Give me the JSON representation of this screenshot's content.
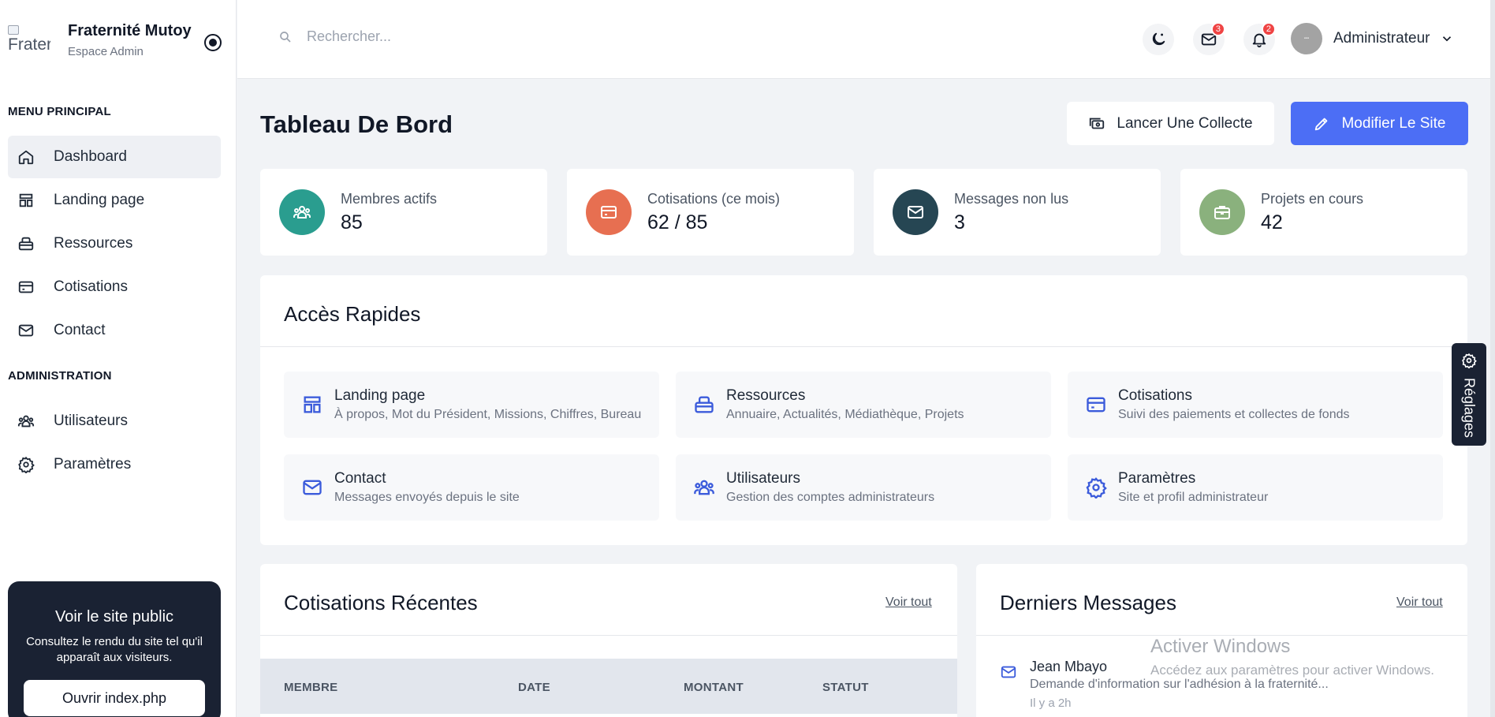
{
  "brand": {
    "logo_alt": "Frater",
    "name": "Fraternité Mutoy",
    "subtitle": "Espace Admin"
  },
  "sidebar": {
    "menu_title": "MENU PRINCIPAL",
    "items": [
      {
        "label": "Dashboard",
        "icon": "home-icon",
        "active": true
      },
      {
        "label": "Landing page",
        "icon": "layout-icon"
      },
      {
        "label": "Ressources",
        "icon": "archive-icon"
      },
      {
        "label": "Cotisations",
        "icon": "credit-card-icon"
      },
      {
        "label": "Contact",
        "icon": "mail-icon"
      }
    ],
    "admin_title": "ADMINISTRATION",
    "admin_items": [
      {
        "label": "Utilisateurs",
        "icon": "users-icon"
      },
      {
        "label": "Paramètres",
        "icon": "gear-icon"
      }
    ],
    "public_card": {
      "title": "Voir le site public",
      "text": "Consultez le rendu du site tel qu'il apparaît aux visiteurs.",
      "button": "Ouvrir index.php"
    }
  },
  "topbar": {
    "search_placeholder": "Rechercher...",
    "messages_count": "3",
    "notifications_count": "2",
    "user_name": "Administrateur"
  },
  "main": {
    "title": "Tableau De Bord",
    "btn_collect": "Lancer Une Collecte",
    "btn_edit": "Modifier Le Site"
  },
  "stats": [
    {
      "label": "Membres actifs",
      "value": "85",
      "color": "#2a9d8f",
      "icon": "users-icon"
    },
    {
      "label": "Cotisations (ce mois)",
      "value": "62 / 85",
      "color": "#e76f51",
      "icon": "credit-card-icon"
    },
    {
      "label": "Messages non lus",
      "value": "3",
      "color": "#264653",
      "icon": "mail-icon"
    },
    {
      "label": "Projets en cours",
      "value": "42",
      "color": "#8ab17d",
      "icon": "briefcase-icon"
    }
  ],
  "quick_access": {
    "title": "Accès Rapides",
    "items": [
      {
        "title": "Landing page",
        "desc": "À propos, Mot du Président, Missions, Chiffres, Bureau"
      },
      {
        "title": "Ressources",
        "desc": "Annuaire, Actualités, Médiathèque, Projets"
      },
      {
        "title": "Cotisations",
        "desc": "Suivi des paiements et collectes de fonds"
      },
      {
        "title": "Contact",
        "desc": "Messages envoyés depuis le site"
      },
      {
        "title": "Utilisateurs",
        "desc": "Gestion des comptes administrateurs"
      },
      {
        "title": "Paramètres",
        "desc": "Site et profil administrateur"
      }
    ]
  },
  "recent_contributions": {
    "title": "Cotisations Récentes",
    "see_all": "Voir tout",
    "columns": [
      "MEMBRE",
      "DATE",
      "MONTANT",
      "STATUT"
    ]
  },
  "latest_messages": {
    "title": "Derniers Messages",
    "see_all": "Voir tout",
    "items": [
      {
        "name": "Jean Mbayo",
        "text": "Demande d'information sur l'adhésion à la fraternité...",
        "time": "Il y a 2h"
      }
    ]
  },
  "settings_tab": {
    "label": "Réglages"
  },
  "watermark": {
    "title": "Activer Windows",
    "subtitle": "Accédez aux paramètres pour activer Windows."
  },
  "colors": {
    "accent": "#4c6ef5",
    "dark": "#1a2233",
    "icon_blue": "#3b5bdb"
  }
}
